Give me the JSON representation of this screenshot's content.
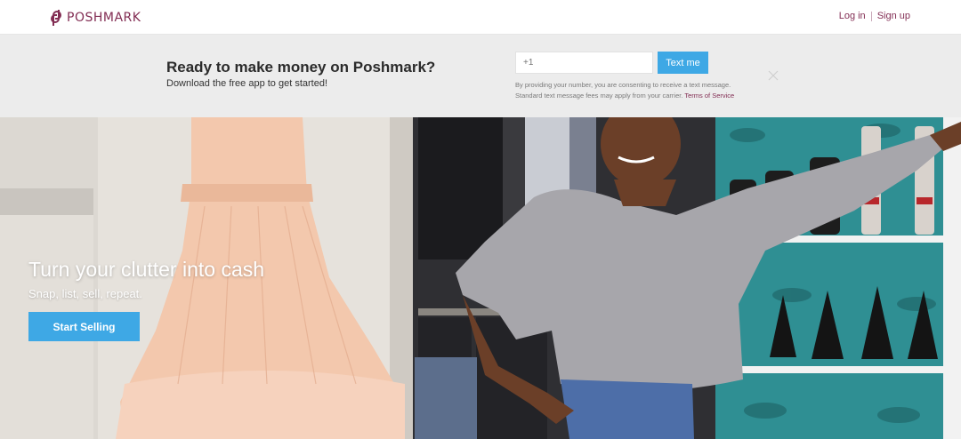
{
  "header": {
    "logo_text": "POSHMARK",
    "login_label": "Log in",
    "signup_label": "Sign up"
  },
  "promo": {
    "title": "Ready to make money on Poshmark?",
    "subtitle": "Download the free app to get started!",
    "phone_placeholder": "+1",
    "text_me_label": "Text me",
    "disclaimer_line1": "By providing your number, you are consenting to receive a text message.",
    "disclaimer_line2": "Standard text message fees may apply from your carrier.",
    "terms_label": "Terms of Service"
  },
  "hero": {
    "title": "Turn your clutter into cash",
    "subtitle": "Snap, list, sell, repeat.",
    "cta_label": "Start Selling",
    "image_description": ""
  },
  "colors": {
    "brand": "#822d53",
    "accent": "#3ea8e5",
    "banner_bg": "#ececec"
  }
}
